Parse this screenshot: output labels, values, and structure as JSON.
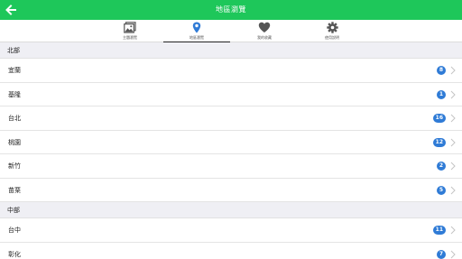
{
  "header": {
    "title": "地區瀏覽",
    "back_icon": "arrow-left-icon",
    "color": "#1ec75a"
  },
  "tabs": [
    {
      "label": "主題瀏覽",
      "icon": "image-icon",
      "active": false
    },
    {
      "label": "地區瀏覽",
      "icon": "map-pin-icon",
      "active": true
    },
    {
      "label": "我的收藏",
      "icon": "heart-icon",
      "active": false
    },
    {
      "label": "使用說明",
      "icon": "gear-icon",
      "active": false
    }
  ],
  "sections": [
    {
      "title": "北部",
      "items": [
        {
          "name": "宜蘭",
          "count": "8"
        },
        {
          "name": "基隆",
          "count": "1"
        },
        {
          "name": "台北",
          "count": "16"
        },
        {
          "name": "桃園",
          "count": "12"
        },
        {
          "name": "新竹",
          "count": "2"
        },
        {
          "name": "苗栗",
          "count": "5"
        }
      ]
    },
    {
      "title": "中部",
      "items": [
        {
          "name": "台中",
          "count": "11"
        },
        {
          "name": "彰化",
          "count": "7"
        }
      ]
    }
  ],
  "colors": {
    "badge": "#2f7bd6",
    "tab_icon": "#555555",
    "tab_icon_active": "#2f7bd6"
  }
}
